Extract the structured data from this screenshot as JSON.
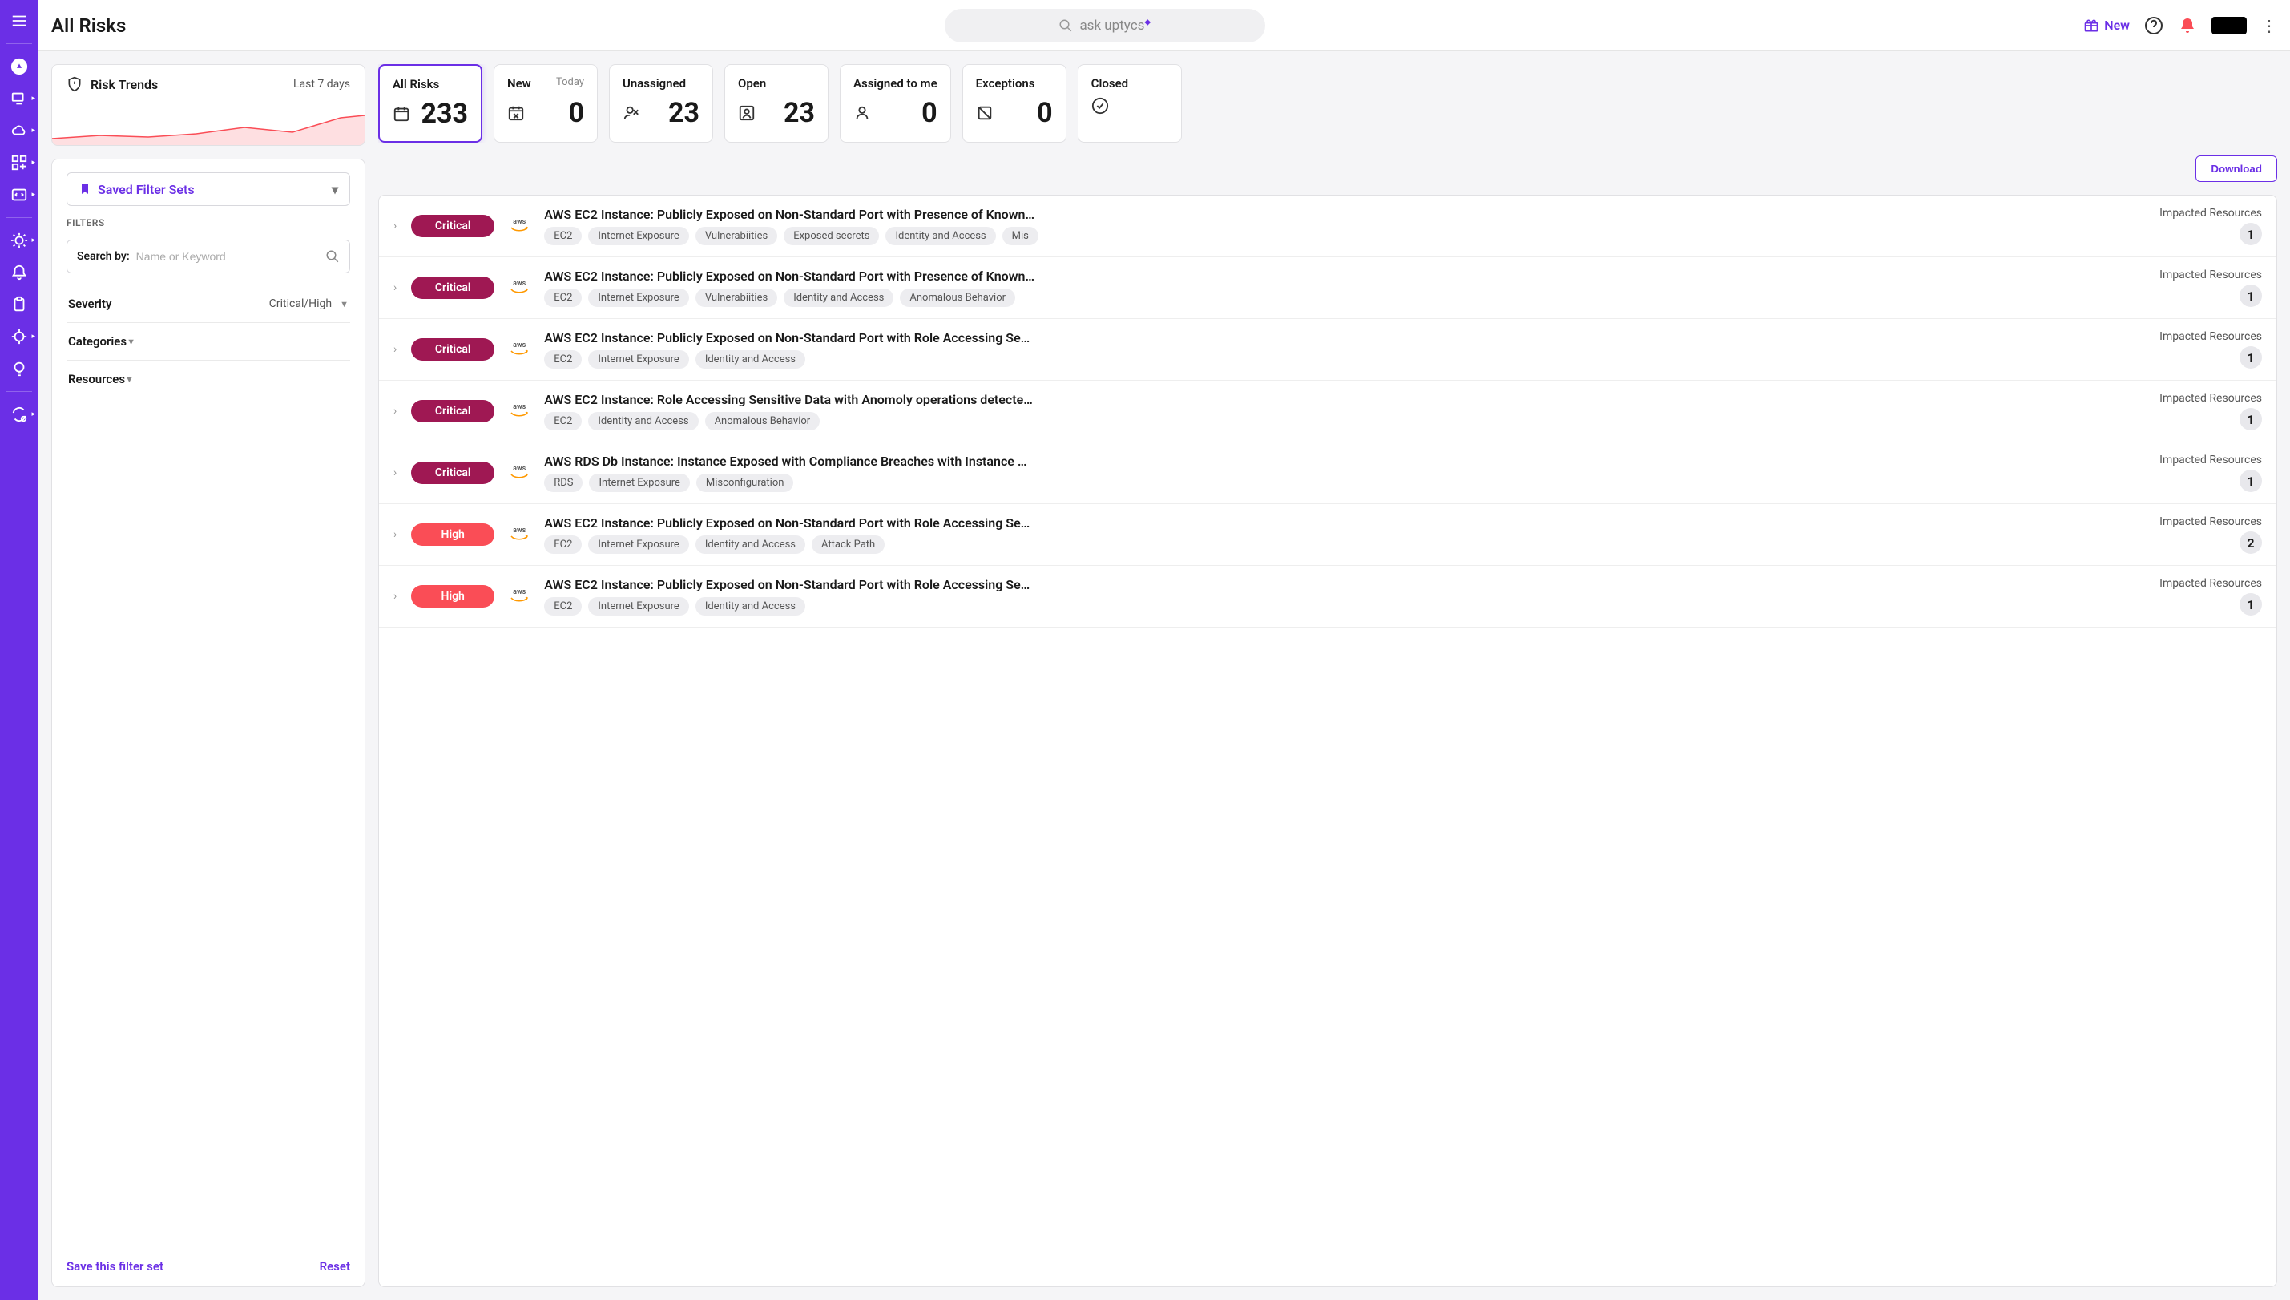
{
  "header": {
    "title": "All Risks",
    "search_placeholder": "ask uptycs",
    "new_label": "New"
  },
  "trends": {
    "title": "Risk Trends",
    "period": "Last 7 days"
  },
  "stats": [
    {
      "label": "All Risks",
      "sub": "",
      "value": "233",
      "icon": "calendar",
      "active": true
    },
    {
      "label": "New",
      "sub": "Today",
      "value": "0",
      "icon": "calendar-x",
      "active": false
    },
    {
      "label": "Unassigned",
      "sub": "",
      "value": "23",
      "icon": "user-off",
      "active": false
    },
    {
      "label": "Open",
      "sub": "",
      "value": "23",
      "icon": "user-box",
      "active": false
    },
    {
      "label": "Assigned to me",
      "sub": "",
      "value": "0",
      "icon": "person",
      "active": false
    },
    {
      "label": "Exceptions",
      "sub": "",
      "value": "0",
      "icon": "slash-box",
      "active": false
    },
    {
      "label": "Closed",
      "sub": "",
      "value": "",
      "icon": "check-circle",
      "active": false
    }
  ],
  "download_label": "Download",
  "filters": {
    "saved_label": "Saved Filter Sets",
    "section_label": "FILTERS",
    "search_label": "Search by:",
    "search_placeholder": "Name or Keyword",
    "accordion": [
      {
        "title": "Severity",
        "value": "Critical/High"
      },
      {
        "title": "Categories",
        "value": ""
      },
      {
        "title": "Resources",
        "value": ""
      }
    ],
    "save_label": "Save this filter set",
    "reset_label": "Reset"
  },
  "impacted_label": "Impacted Resources",
  "risks": [
    {
      "severity": "Critical",
      "provider": "aws",
      "title": "AWS EC2 Instance: Publicly Exposed on Non-Standard Port with Presence of Known…",
      "tags": [
        "EC2",
        "Internet Exposure",
        "Vulnerabiities",
        "Exposed secrets",
        "Identity and Access",
        "Mis"
      ],
      "impacted": 1
    },
    {
      "severity": "Critical",
      "provider": "aws",
      "title": "AWS EC2 Instance: Publicly Exposed on Non-Standard Port with Presence of Known…",
      "tags": [
        "EC2",
        "Internet Exposure",
        "Vulnerabiities",
        "Identity and Access",
        "Anomalous Behavior"
      ],
      "impacted": 1
    },
    {
      "severity": "Critical",
      "provider": "aws",
      "title": "AWS EC2 Instance: Publicly Exposed on Non-Standard Port with Role Accessing Se…",
      "tags": [
        "EC2",
        "Internet Exposure",
        "Identity and Access"
      ],
      "impacted": 1
    },
    {
      "severity": "Critical",
      "provider": "aws",
      "title": "AWS EC2 Instance: Role Accessing Sensitive Data with Anomoly operations detecte…",
      "tags": [
        "EC2",
        "Identity and Access",
        "Anomalous Behavior"
      ],
      "impacted": 1
    },
    {
      "severity": "Critical",
      "provider": "aws",
      "title": "AWS RDS Db Instance: Instance Exposed with Compliance Breaches with Instance …",
      "tags": [
        "RDS",
        "Internet Exposure",
        "Misconfiguration"
      ],
      "impacted": 1
    },
    {
      "severity": "High",
      "provider": "aws",
      "title": "AWS EC2 Instance: Publicly Exposed on Non-Standard Port with Role Accessing Se…",
      "tags": [
        "EC2",
        "Internet Exposure",
        "Identity and Access",
        "Attack Path"
      ],
      "impacted": 2
    },
    {
      "severity": "High",
      "provider": "aws",
      "title": "AWS EC2 Instance: Publicly Exposed on Non-Standard Port with Role Accessing Se…",
      "tags": [
        "EC2",
        "Internet Exposure",
        "Identity and Access"
      ],
      "impacted": 1
    }
  ],
  "chart_data": {
    "type": "area",
    "title": "Risk Trends",
    "period_days": 7,
    "x": [
      1,
      2,
      3,
      4,
      5,
      6,
      7
    ],
    "values": [
      8,
      12,
      10,
      14,
      22,
      16,
      34
    ],
    "ylim": [
      0,
      40
    ],
    "color": "#FA4D56"
  }
}
